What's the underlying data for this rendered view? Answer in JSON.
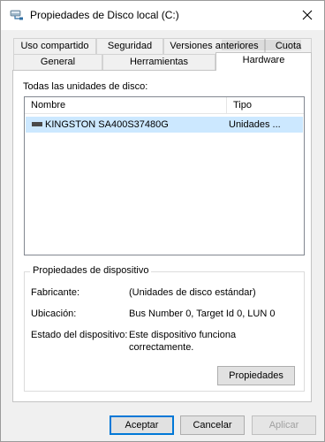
{
  "window": {
    "title": "Propiedades de Disco local (C:)",
    "title_icon": "drive-network-icon",
    "close_icon": "close-icon"
  },
  "tabs_top": [
    {
      "label": "Uso compartido"
    },
    {
      "label": "Seguridad"
    },
    {
      "label": "Versiones anteriores"
    },
    {
      "label": "Cuota"
    }
  ],
  "tabs_bottom": [
    {
      "label": "General"
    },
    {
      "label": "Herramientas"
    },
    {
      "label": "Hardware",
      "active": true
    }
  ],
  "hardware": {
    "list_label": "Todas las unidades de disco:",
    "columns": {
      "name": "Nombre",
      "type": "Tipo"
    },
    "rows": [
      {
        "name": "KINGSTON SA400S37480G",
        "type": "Unidades ...",
        "selected": true,
        "icon": "disk-drive-icon"
      }
    ],
    "device_properties": {
      "title": "Propiedades de dispositivo",
      "manufacturer_label": "Fabricante:",
      "manufacturer_value": "(Unidades de disco estándar)",
      "location_label": "Ubicación:",
      "location_value": "Bus Number 0, Target Id 0, LUN 0",
      "status_label": "Estado del dispositivo:",
      "status_value_line1": "Este dispositivo funciona",
      "status_value_line2": "correctamente.",
      "properties_button": "Propiedades"
    }
  },
  "footer": {
    "accept": "Aceptar",
    "cancel": "Cancelar",
    "apply": "Aplicar"
  },
  "colors": {
    "selection": "#cce8ff",
    "default_button_border": "#0078d7",
    "window_bg": "#f0f0f0"
  }
}
